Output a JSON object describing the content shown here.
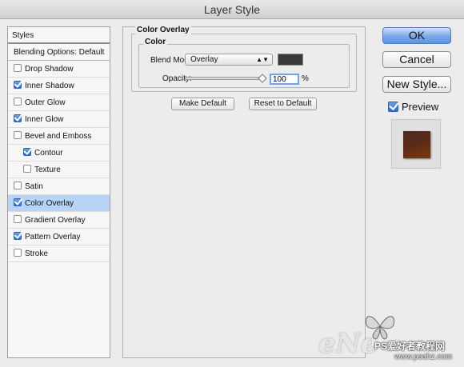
{
  "window": {
    "title": "Layer Style"
  },
  "sidebar": {
    "header": "Styles",
    "blending_options": "Blending Options: Default",
    "items": [
      {
        "label": "Drop Shadow",
        "checked": false
      },
      {
        "label": "Inner Shadow",
        "checked": true
      },
      {
        "label": "Outer Glow",
        "checked": false
      },
      {
        "label": "Inner Glow",
        "checked": true
      },
      {
        "label": "Bevel and Emboss",
        "checked": false
      },
      {
        "label": "Contour",
        "checked": true
      },
      {
        "label": "Texture",
        "checked": false
      },
      {
        "label": "Satin",
        "checked": false
      },
      {
        "label": "Color Overlay",
        "checked": true,
        "selected": true
      },
      {
        "label": "Gradient Overlay",
        "checked": false
      },
      {
        "label": "Pattern Overlay",
        "checked": true
      },
      {
        "label": "Stroke",
        "checked": false
      }
    ]
  },
  "panel": {
    "title": "Color Overlay",
    "group_title": "Color",
    "blend_mode_label": "Blend Mode:",
    "blend_mode_value": "Overlay",
    "overlay_color": "#3a3a3a",
    "opacity_label": "Opacity:",
    "opacity_value": "100",
    "opacity_unit": "%",
    "opacity_fraction": 1.0,
    "make_default_label": "Make Default",
    "reset_default_label": "Reset to Default"
  },
  "buttons": {
    "ok_label": "OK",
    "cancel_label": "Cancel",
    "new_style_label": "New Style...",
    "preview_label": "Preview",
    "preview_checked": true
  },
  "watermark": {
    "logo_text": "eNe",
    "site_name": "PS爱好者教程网",
    "url": "www.psahz.com"
  },
  "colors": {
    "accent": "#5d95e2",
    "selection": "#b7d3f5"
  }
}
